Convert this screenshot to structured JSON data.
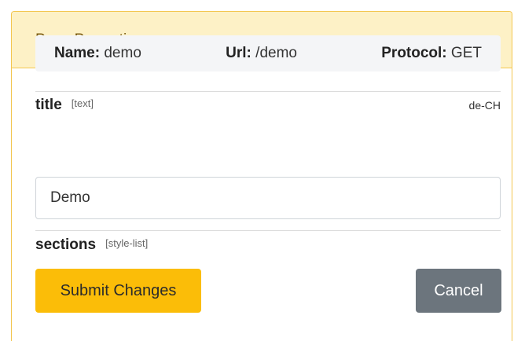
{
  "panel": {
    "title": "Page Properties"
  },
  "info": {
    "name_key": "Name:",
    "name_value": "demo",
    "url_key": "Url:",
    "url_value": "/demo",
    "protocol_key": "Protocol:",
    "protocol_value": "GET"
  },
  "fields": {
    "title": {
      "name": "title",
      "type": "[text]",
      "locale": "de-CH",
      "value": "Demo"
    },
    "sections": {
      "name": "sections",
      "type": "[style-list]"
    }
  },
  "actions": {
    "submit_label": "Submit Changes",
    "cancel_label": "Cancel"
  },
  "colors": {
    "header_bg": "#fdf1c6",
    "border": "#f3c64f",
    "submit_bg": "#fbbd08",
    "cancel_bg": "#6c757d"
  }
}
